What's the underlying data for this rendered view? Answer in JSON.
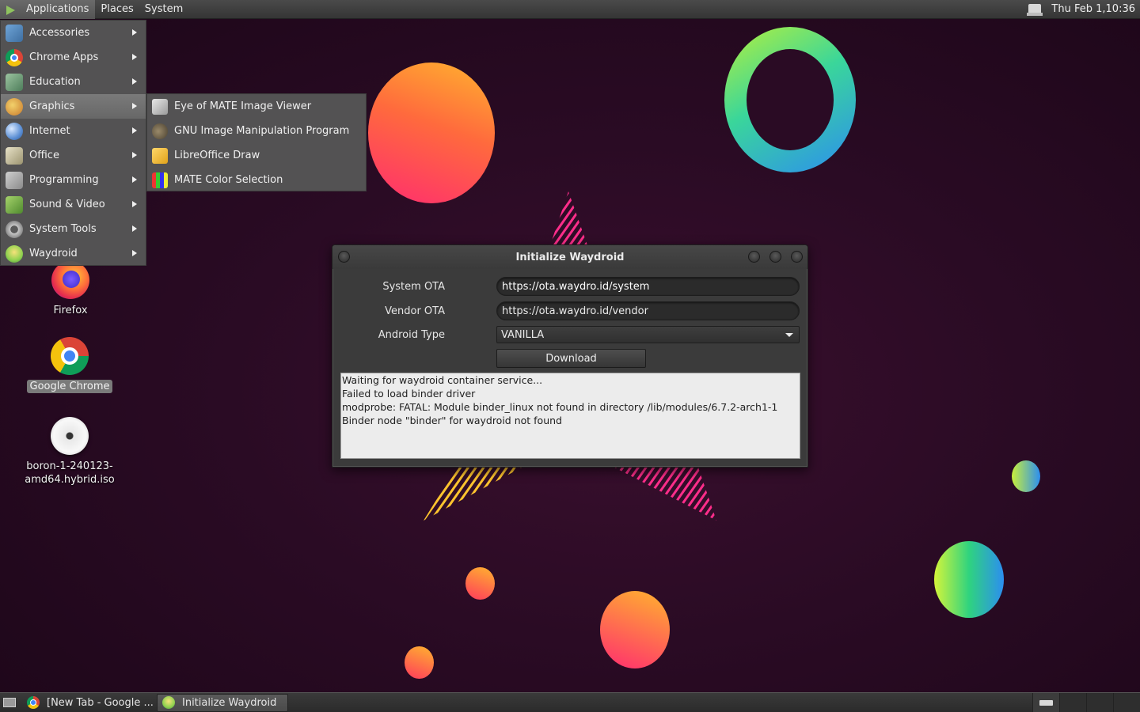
{
  "top_panel": {
    "menus": [
      "Applications",
      "Places",
      "System"
    ],
    "clock": "Thu Feb  1,10:36"
  },
  "app_menu": {
    "items": [
      {
        "label": "Accessories",
        "icon": "accessories-icon"
      },
      {
        "label": "Chrome Apps",
        "icon": "chrome-icon"
      },
      {
        "label": "Education",
        "icon": "education-icon"
      },
      {
        "label": "Graphics",
        "icon": "graphics-icon"
      },
      {
        "label": "Internet",
        "icon": "internet-icon"
      },
      {
        "label": "Office",
        "icon": "office-icon"
      },
      {
        "label": "Programming",
        "icon": "programming-icon"
      },
      {
        "label": "Sound & Video",
        "icon": "sound-video-icon"
      },
      {
        "label": "System Tools",
        "icon": "system-tools-icon"
      },
      {
        "label": "Waydroid",
        "icon": "waydroid-icon"
      }
    ],
    "active_item": "Graphics"
  },
  "graphics_submenu": {
    "items": [
      {
        "label": "Eye of MATE Image Viewer",
        "icon": "image-viewer-icon"
      },
      {
        "label": "GNU Image Manipulation Program",
        "icon": "gimp-icon"
      },
      {
        "label": "LibreOffice Draw",
        "icon": "libreoffice-draw-icon"
      },
      {
        "label": "MATE Color Selection",
        "icon": "color-selection-icon"
      }
    ]
  },
  "desktop_icons": [
    {
      "label": "Firefox",
      "icon": "firefox-icon"
    },
    {
      "label": "Google Chrome",
      "icon": "chrome-icon"
    },
    {
      "label_line1": "boron-1-240123-",
      "label_line2": "amd64.hybrid.iso",
      "icon": "disc-image-icon"
    }
  ],
  "dialog": {
    "title": "Initialize Waydroid",
    "system_ota": {
      "label": "System OTA",
      "value": "https://ota.waydro.id/system"
    },
    "vendor_ota": {
      "label": "Vendor OTA",
      "value": "https://ota.waydro.id/vendor"
    },
    "android_type": {
      "label": "Android Type",
      "value": "VANILLA"
    },
    "download_label": "Download",
    "log": [
      "Waiting for waydroid container service...",
      "Failed to load binder driver",
      "modprobe: FATAL: Module binder_linux not found in directory /lib/modules/6.7.2-arch1-1",
      "Binder node \"binder\" for waydroid not found"
    ]
  },
  "taskbar": {
    "tasks": [
      {
        "label": "[New Tab - Google ...",
        "icon": "chrome-icon",
        "active": false
      },
      {
        "label": "Initialize Waydroid",
        "icon": "waydroid-icon",
        "active": true
      }
    ]
  }
}
